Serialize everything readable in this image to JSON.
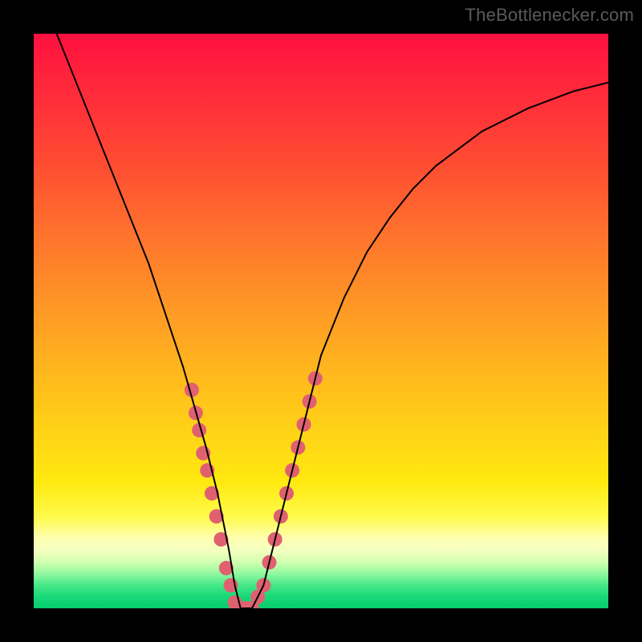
{
  "watermark": {
    "text": "TheBottlenecker.com"
  },
  "chart_data": {
    "type": "line",
    "title": "",
    "xlabel": "",
    "ylabel": "",
    "xlim": [
      0,
      100
    ],
    "ylim": [
      0,
      100
    ],
    "series": [
      {
        "name": "curve",
        "x": [
          4,
          6,
          8,
          10,
          12,
          14,
          16,
          18,
          20,
          22,
          24,
          26,
          28,
          30,
          32,
          34,
          35,
          36,
          37,
          38,
          40,
          42,
          44,
          46,
          48,
          50,
          54,
          58,
          62,
          66,
          70,
          74,
          78,
          82,
          86,
          90,
          94,
          98,
          100
        ],
        "y": [
          100,
          95,
          90,
          85,
          80,
          75,
          70,
          65,
          60,
          54,
          48,
          42,
          35,
          28,
          20,
          10,
          4,
          0,
          0,
          0,
          4,
          12,
          20,
          28,
          36,
          44,
          54,
          62,
          68,
          73,
          77,
          80,
          83,
          85,
          87,
          88.5,
          90,
          91,
          91.5
        ]
      }
    ],
    "markers": [
      {
        "x": 27.5,
        "y": 38
      },
      {
        "x": 28.2,
        "y": 34
      },
      {
        "x": 28.8,
        "y": 31
      },
      {
        "x": 29.5,
        "y": 27
      },
      {
        "x": 30.2,
        "y": 24
      },
      {
        "x": 31.0,
        "y": 20
      },
      {
        "x": 31.8,
        "y": 16
      },
      {
        "x": 32.6,
        "y": 12
      },
      {
        "x": 33.5,
        "y": 7
      },
      {
        "x": 34.3,
        "y": 4
      },
      {
        "x": 35.0,
        "y": 1
      },
      {
        "x": 36.0,
        "y": 0
      },
      {
        "x": 37.0,
        "y": 0
      },
      {
        "x": 38.0,
        "y": 0
      },
      {
        "x": 39.0,
        "y": 2
      },
      {
        "x": 40.0,
        "y": 4
      },
      {
        "x": 41.0,
        "y": 8
      },
      {
        "x": 42.0,
        "y": 12
      },
      {
        "x": 43.0,
        "y": 16
      },
      {
        "x": 44.0,
        "y": 20
      },
      {
        "x": 45.0,
        "y": 24
      },
      {
        "x": 46.0,
        "y": 28
      },
      {
        "x": 47.0,
        "y": 32
      },
      {
        "x": 48.0,
        "y": 36
      },
      {
        "x": 49.0,
        "y": 40
      }
    ],
    "marker_color": "#e06070",
    "marker_radius": 9,
    "curve_stroke": "#000000",
    "curve_width": 2
  }
}
